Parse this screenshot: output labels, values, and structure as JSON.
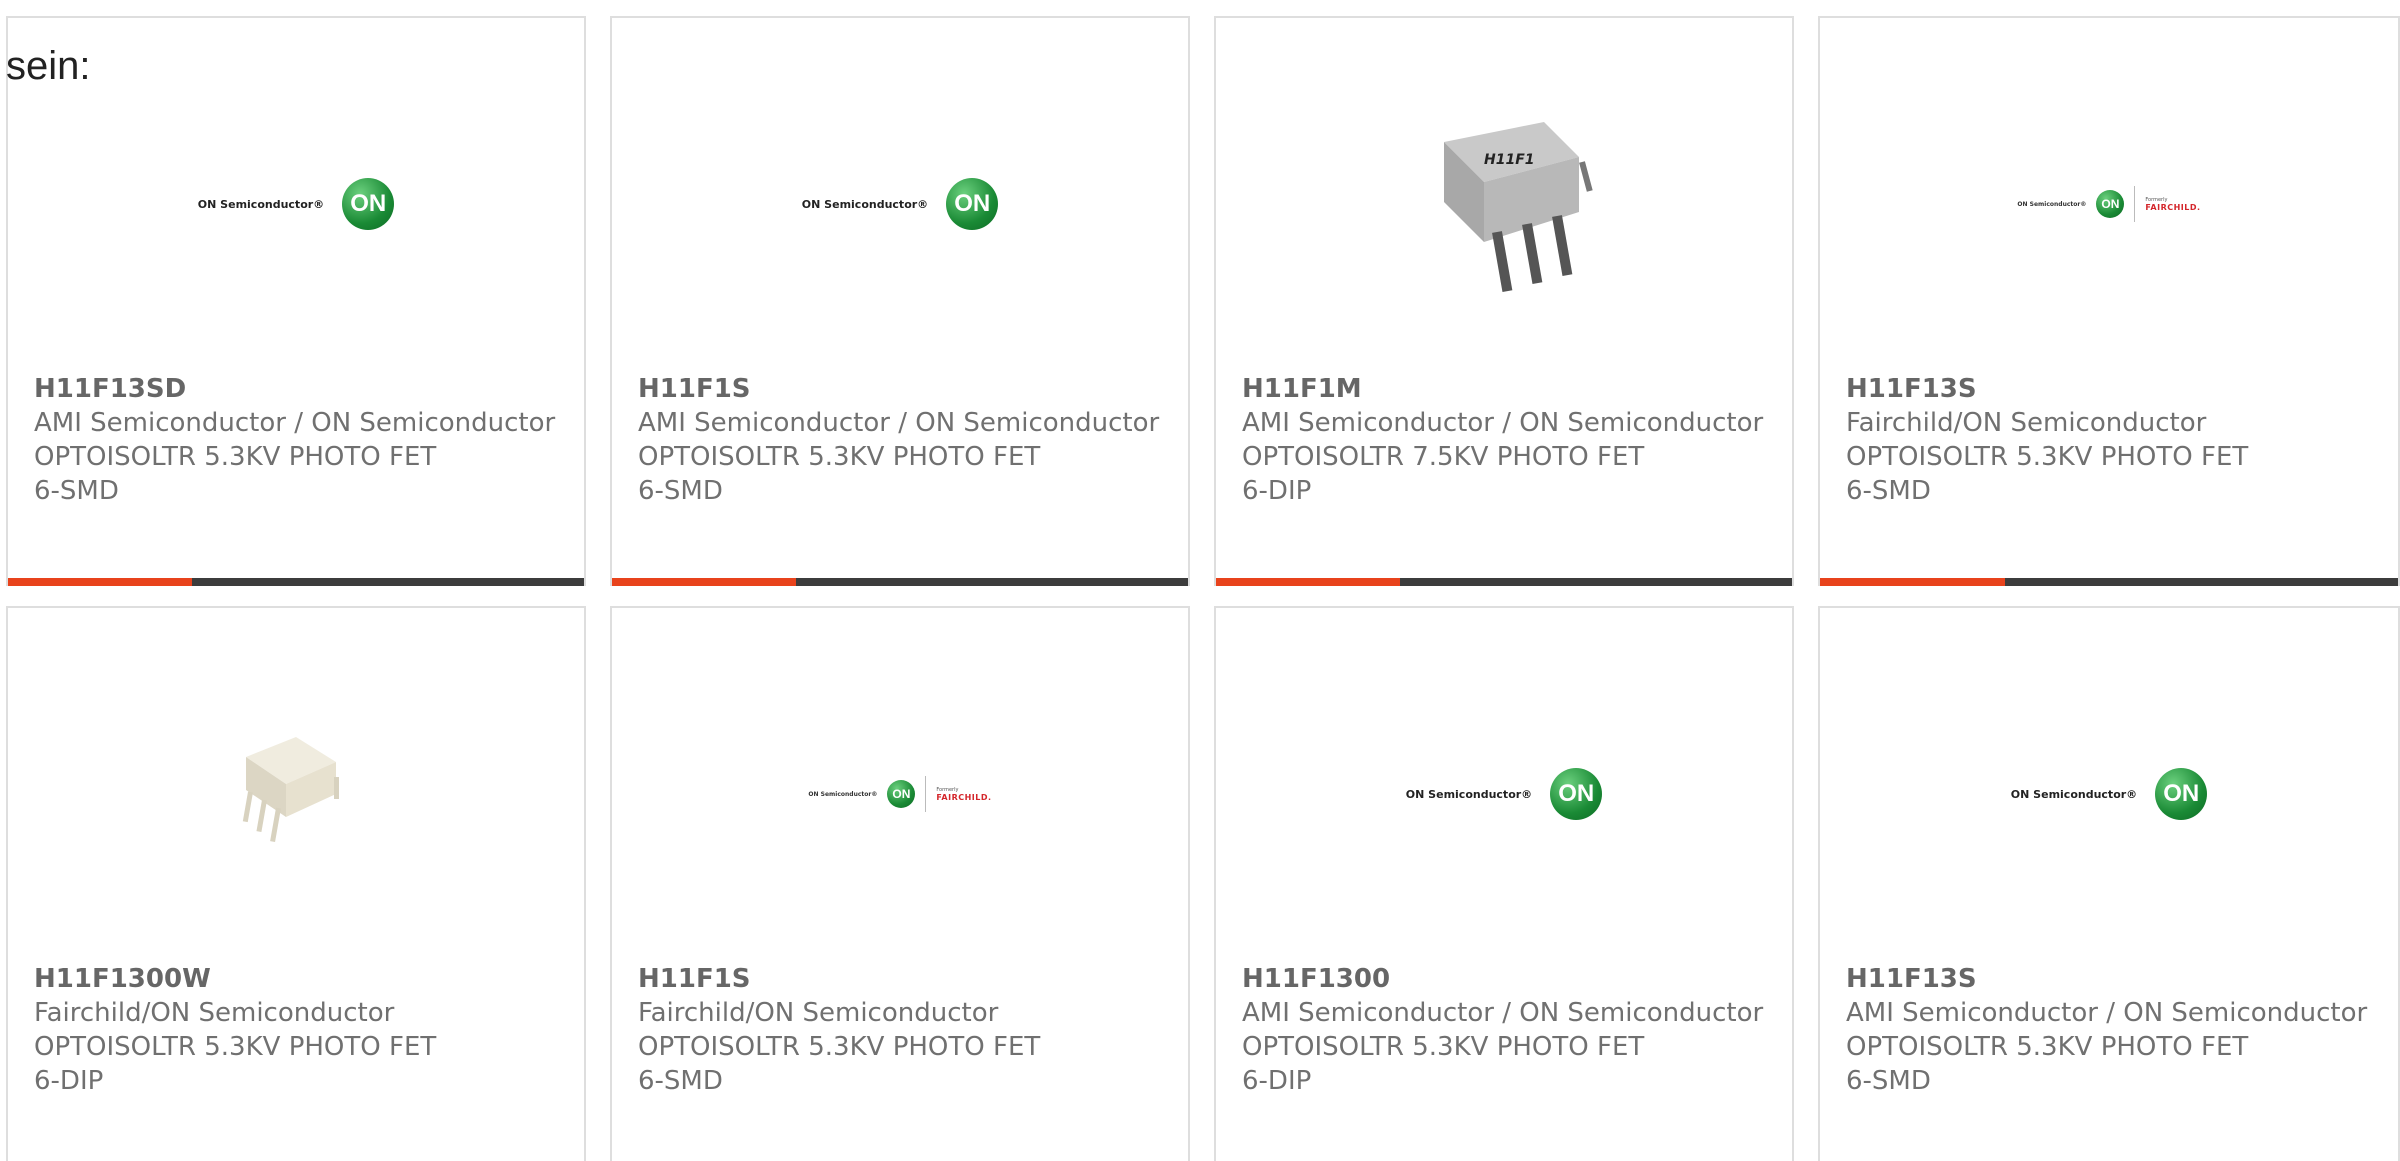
{
  "lead_text": "sein:",
  "accent_color": "#e8431c",
  "cards": [
    {
      "part": "H11F13SD",
      "manufacturer": "AMI Semiconductor / ON Semiconductor",
      "description": "OPTOISOLTR 5.3KV PHOTO FET",
      "package": "6-SMD",
      "image": "on-semi-logo",
      "has_bar": true
    },
    {
      "part": "H11F1S",
      "manufacturer": "AMI Semiconductor / ON Semiconductor",
      "description": "OPTOISOLTR 5.3KV PHOTO FET",
      "package": "6-SMD",
      "image": "on-semi-logo",
      "has_bar": true
    },
    {
      "part": "H11F1M",
      "manufacturer": "AMI Semiconductor / ON Semiconductor",
      "description": "OPTOISOLTR 7.5KV PHOTO FET",
      "package": "6-DIP",
      "image": "chip-grey-dip",
      "chip_marking": "H11F1",
      "has_bar": true
    },
    {
      "part": "H11F13S",
      "manufacturer": "Fairchild/ON Semiconductor",
      "description": "OPTOISOLTR 5.3KV PHOTO FET",
      "package": "6-SMD",
      "image": "on-fairchild-logo",
      "has_bar": true
    },
    {
      "part": "H11F1300W",
      "manufacturer": "Fairchild/ON Semiconductor",
      "description": "OPTOISOLTR 5.3KV PHOTO FET",
      "package": "6-DIP",
      "image": "chip-white-dip",
      "has_bar": false
    },
    {
      "part": "H11F1S",
      "manufacturer": "Fairchild/ON Semiconductor",
      "description": "OPTOISOLTR 5.3KV PHOTO FET",
      "package": "6-SMD",
      "image": "on-fairchild-logo",
      "has_bar": false
    },
    {
      "part": "H11F1300",
      "manufacturer": "AMI Semiconductor / ON Semiconductor",
      "description": "OPTOISOLTR 5.3KV PHOTO FET",
      "package": "6-DIP",
      "image": "on-semi-logo",
      "has_bar": false
    },
    {
      "part": "H11F13S",
      "manufacturer": "AMI Semiconductor / ON Semiconductor",
      "description": "OPTOISOLTR 5.3KV PHOTO FET",
      "package": "6-SMD",
      "image": "on-semi-logo",
      "has_bar": false
    }
  ],
  "logos": {
    "on_text": "ON Semiconductor®",
    "on_mark": "ON",
    "formerly": "Formerly",
    "fairchild": "FAIRCHILD."
  }
}
